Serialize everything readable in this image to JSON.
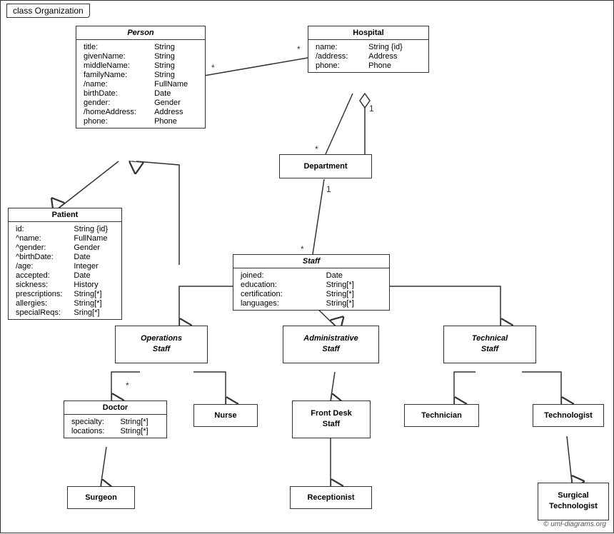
{
  "diagram": {
    "title": "class Organization",
    "copyright": "© uml-diagrams.org",
    "classes": {
      "person": {
        "name": "Person",
        "italic": true,
        "attrs": [
          [
            "title:",
            "String"
          ],
          [
            "givenName:",
            "String"
          ],
          [
            "middleName:",
            "String"
          ],
          [
            "familyName:",
            "String"
          ],
          [
            "/name:",
            "FullName"
          ],
          [
            "birthDate:",
            "Date"
          ],
          [
            "gender:",
            "Gender"
          ],
          [
            "/homeAddress:",
            "Address"
          ],
          [
            "phone:",
            "Phone"
          ]
        ]
      },
      "hospital": {
        "name": "Hospital",
        "italic": false,
        "attrs": [
          [
            "name:",
            "String {id}"
          ],
          [
            "/address:",
            "Address"
          ],
          [
            "phone:",
            "Phone"
          ]
        ]
      },
      "patient": {
        "name": "Patient",
        "italic": false,
        "attrs": [
          [
            "id:",
            "String {id}"
          ],
          [
            "^name:",
            "FullName"
          ],
          [
            "^gender:",
            "Gender"
          ],
          [
            "^birthDate:",
            "Date"
          ],
          [
            "/age:",
            "Integer"
          ],
          [
            "accepted:",
            "Date"
          ],
          [
            "sickness:",
            "History"
          ],
          [
            "prescriptions:",
            "String[*]"
          ],
          [
            "allergies:",
            "String[*]"
          ],
          [
            "specialReqs:",
            "Sring[*]"
          ]
        ]
      },
      "department": {
        "name": "Department",
        "italic": false,
        "attrs": []
      },
      "staff": {
        "name": "Staff",
        "italic": true,
        "attrs": [
          [
            "joined:",
            "Date"
          ],
          [
            "education:",
            "String[*]"
          ],
          [
            "certification:",
            "String[*]"
          ],
          [
            "languages:",
            "String[*]"
          ]
        ]
      },
      "operations_staff": {
        "name": "Operations\nStaff",
        "italic": true,
        "attrs": []
      },
      "administrative_staff": {
        "name": "Administrative\nStaff",
        "italic": true,
        "attrs": []
      },
      "technical_staff": {
        "name": "Technical\nStaff",
        "italic": true,
        "attrs": []
      },
      "doctor": {
        "name": "Doctor",
        "italic": false,
        "attrs": [
          [
            "specialty:",
            "String[*]"
          ],
          [
            "locations:",
            "String[*]"
          ]
        ]
      },
      "nurse": {
        "name": "Nurse",
        "italic": false,
        "attrs": []
      },
      "front_desk_staff": {
        "name": "Front Desk\nStaff",
        "italic": false,
        "attrs": []
      },
      "technician": {
        "name": "Technician",
        "italic": false,
        "attrs": []
      },
      "technologist": {
        "name": "Technologist",
        "italic": false,
        "attrs": []
      },
      "surgeon": {
        "name": "Surgeon",
        "italic": false,
        "attrs": []
      },
      "receptionist": {
        "name": "Receptionist",
        "italic": false,
        "attrs": []
      },
      "surgical_technologist": {
        "name": "Surgical\nTechnologist",
        "italic": false,
        "attrs": []
      }
    }
  }
}
